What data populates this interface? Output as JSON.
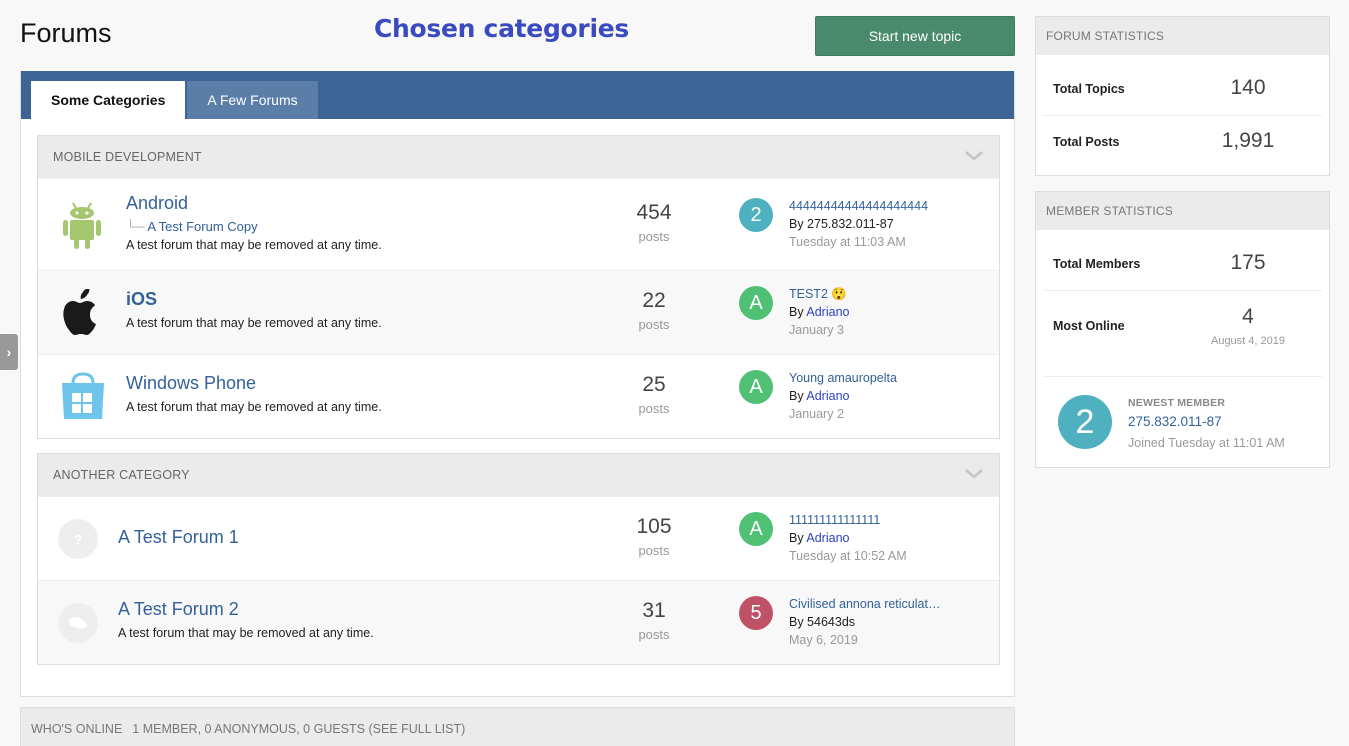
{
  "page": {
    "title": "Forums",
    "annotation": "Chosen categories",
    "new_topic_label": "Start new topic"
  },
  "tabs": [
    {
      "label": "Some Categories",
      "active": true
    },
    {
      "label": "A Few Forums",
      "active": false
    }
  ],
  "categories": [
    {
      "title": "MOBILE DEVELOPMENT",
      "forums": [
        {
          "name": "Android",
          "icon": "android-icon",
          "subforum": "A Test Forum Copy",
          "description": "A test forum that may be removed at any time.",
          "posts": "454",
          "posts_label": "posts",
          "last_avatar": "2",
          "last_avatar_color": "#4fb1bf",
          "last_title": "44444444444444444444",
          "last_by_prefix": "By 275.832.011-87",
          "last_by_user": "",
          "last_date": "Tuesday at 11:03 AM"
        },
        {
          "name": "iOS",
          "icon": "apple-icon",
          "subforum": "",
          "description": "A test forum that may be removed at any time.",
          "posts": "22",
          "posts_label": "posts",
          "last_avatar": "A",
          "last_avatar_color": "#4fc074",
          "last_title": "TEST2",
          "last_title_emoji": "😲",
          "last_by_prefix": "By",
          "last_by_user": "Adriano",
          "last_date": "January 3"
        },
        {
          "name": "Windows Phone",
          "icon": "windows-store-icon",
          "subforum": "",
          "description": "A test forum that may be removed at any time.",
          "posts": "25",
          "posts_label": "posts",
          "last_avatar": "A",
          "last_avatar_color": "#4fc074",
          "last_title": "Young amauropelta",
          "last_by_prefix": "By",
          "last_by_user": "Adriano",
          "last_date": "January 2"
        }
      ]
    },
    {
      "title": "ANOTHER CATEGORY",
      "forums": [
        {
          "name": "A Test Forum 1",
          "icon": "question-icon",
          "description": "",
          "posts": "105",
          "posts_label": "posts",
          "last_avatar": "A",
          "last_avatar_color": "#4fc074",
          "last_title": "111111111111111",
          "last_by_prefix": "By",
          "last_by_user": "Adriano",
          "last_date": "Tuesday at 10:52 AM"
        },
        {
          "name": "A Test Forum 2",
          "icon": "chat-bubbles-icon",
          "description": "A test forum that may be removed at any time.",
          "posts": "31",
          "posts_label": "posts",
          "last_avatar": "5",
          "last_avatar_color": "#c05268",
          "last_title": "Civilised annona reticulat…",
          "last_by_prefix": "By 54643ds",
          "last_by_user": "",
          "last_date": "May 6, 2019"
        }
      ]
    }
  ],
  "whos_online": {
    "label": "WHO'S ONLINE",
    "summary": "1 MEMBER, 0 ANONYMOUS, 0 GUESTS",
    "link": "(SEE FULL LIST)"
  },
  "forum_statistics": {
    "title": "FORUM STATISTICS",
    "total_topics_label": "Total Topics",
    "total_topics": "140",
    "total_posts_label": "Total Posts",
    "total_posts": "1,991"
  },
  "member_statistics": {
    "title": "MEMBER STATISTICS",
    "total_members_label": "Total Members",
    "total_members": "175",
    "most_online_label": "Most Online",
    "most_online": "4",
    "most_online_date": "August 4, 2019",
    "newest_label": "NEWEST MEMBER",
    "newest_avatar": "2",
    "newest_name": "275.832.011-87",
    "newest_joined": "Joined Tuesday at 11:01 AM"
  },
  "colors": {
    "accent": "#3c6494",
    "button": "#4a8a6c",
    "link": "#33619a",
    "annotation": "#3a4bc2"
  }
}
